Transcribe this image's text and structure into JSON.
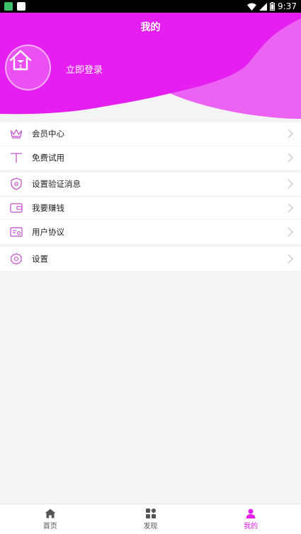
{
  "status_bar": {
    "time": "9:37"
  },
  "header": {
    "title": "我的",
    "login_text": "立即登录"
  },
  "menu_groups": [
    [
      {
        "icon": "crown-icon",
        "label": "会员中心"
      },
      {
        "icon": "free-trial-icon",
        "label": "免费试用"
      }
    ],
    [
      {
        "icon": "shield-gear-icon",
        "label": "设置验证消息"
      },
      {
        "icon": "wallet-icon",
        "label": "我要赚钱"
      },
      {
        "icon": "agreement-icon",
        "label": "用户协议"
      }
    ],
    [
      {
        "icon": "settings-icon",
        "label": "设置"
      }
    ]
  ],
  "tabs": [
    {
      "icon": "home-icon",
      "label": "首页",
      "active": false
    },
    {
      "icon": "discover-icon",
      "label": "发现",
      "active": false
    },
    {
      "icon": "profile-icon",
      "label": "我的",
      "active": true
    }
  ],
  "colors": {
    "accent": "#e41ff0",
    "accent_light": "#ec63f4",
    "icon_stroke": "#c04bc8"
  }
}
